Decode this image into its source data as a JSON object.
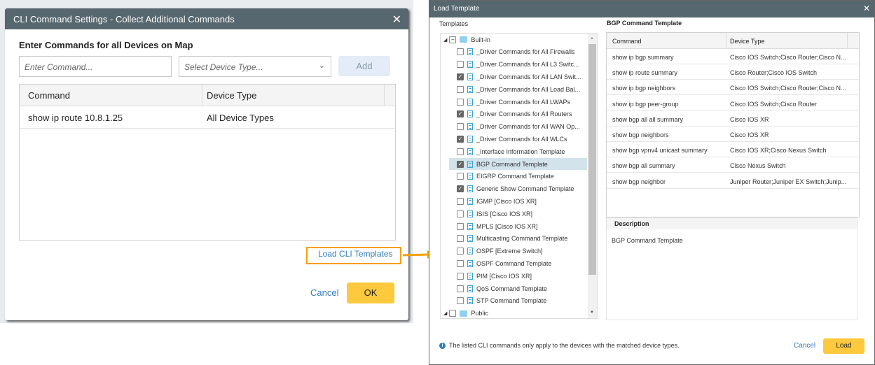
{
  "cli_dialog": {
    "title": "CLI Command Settings - Collect Additional Commands",
    "heading": "Enter Commands for all Devices on Map",
    "command_placeholder": "Enter Command...",
    "device_type_placeholder": "Select Device Type...",
    "add_label": "Add",
    "columns": [
      "Command",
      "Device Type"
    ],
    "rows": [
      {
        "command": "show ip route 10.8.1.25",
        "device_type": "All Device Types"
      }
    ],
    "load_templates_link": "Load CLI Templates",
    "cancel_label": "Cancel",
    "ok_label": "OK"
  },
  "load_dialog": {
    "title": "Load Template",
    "templates_label": "Templates",
    "tree": {
      "builtin_label": "Built-in",
      "public_label": "Public",
      "items": [
        {
          "label": "_Driver Commands for All Firewalls",
          "checked": false
        },
        {
          "label": "_Driver Commands for All L3 Switc...",
          "checked": false
        },
        {
          "label": "_Driver Commands for All LAN Swit...",
          "checked": true
        },
        {
          "label": "_Driver Commands for All Load Bal...",
          "checked": false
        },
        {
          "label": "_Driver Commands for All LWAPs",
          "checked": false
        },
        {
          "label": "_Driver Commands for All Routers",
          "checked": true
        },
        {
          "label": "_Driver Commands for All WAN Op...",
          "checked": false
        },
        {
          "label": "_Driver Commands for All WLCs",
          "checked": true
        },
        {
          "label": "_Interface Information Template",
          "checked": false
        },
        {
          "label": "BGP Command Template",
          "checked": true,
          "selected": true
        },
        {
          "label": "EIGRP Command Template",
          "checked": false
        },
        {
          "label": "Generic Show Command Template",
          "checked": true
        },
        {
          "label": "IGMP [Cisco IOS XR]",
          "checked": false
        },
        {
          "label": "ISIS [Cisco IOS XR]",
          "checked": false
        },
        {
          "label": "MPLS [Cisco IOS XR]",
          "checked": false
        },
        {
          "label": "Multicasting Command Template",
          "checked": false
        },
        {
          "label": "OSPF [Extreme Switch]",
          "checked": false
        },
        {
          "label": "OSPF Command Template",
          "checked": false
        },
        {
          "label": "PIM [Cisco IOS XR]",
          "checked": false
        },
        {
          "label": "QoS Command Template",
          "checked": false
        },
        {
          "label": "STP Command Template",
          "checked": false
        }
      ]
    },
    "selected_template_title": "BGP Command Template",
    "columns": [
      "Command",
      "Device Type"
    ],
    "rows": [
      {
        "command": "show ip bgp summary",
        "device_type": "Cisco IOS Switch;Cisco Router;Cisco N..."
      },
      {
        "command": "show ip route summary",
        "device_type": "Cisco Router;Cisco IOS Switch"
      },
      {
        "command": "show ip bgp neighbors",
        "device_type": "Cisco IOS Switch;Cisco Router;Cisco N..."
      },
      {
        "command": "show ip bgp peer-group",
        "device_type": "Cisco IOS Switch;Cisco Router"
      },
      {
        "command": "show bgp all all summary",
        "device_type": "Cisco IOS XR"
      },
      {
        "command": "show bgp neighbors",
        "device_type": "Cisco IOS XR"
      },
      {
        "command": "show bgp vpnv4 unicast summary",
        "device_type": "Cisco IOS XR;Cisco Nexus Switch"
      },
      {
        "command": "show bgp all summary",
        "device_type": "Cisco Nexus Switch"
      },
      {
        "command": "show bgp neighbor",
        "device_type": "Juniper Router;Juniper EX Switch;Junip..."
      }
    ],
    "description_label": "Description",
    "description": "BGP Command Template",
    "info_text": "The listed CLI commands only apply to the devices with the matched device types.",
    "cancel_label": "Cancel",
    "load_label": "Load"
  },
  "colors": {
    "titlebar": "#57676f",
    "accent": "#fec93d",
    "highlight": "#f5a000",
    "link": "#2f7bbf"
  }
}
